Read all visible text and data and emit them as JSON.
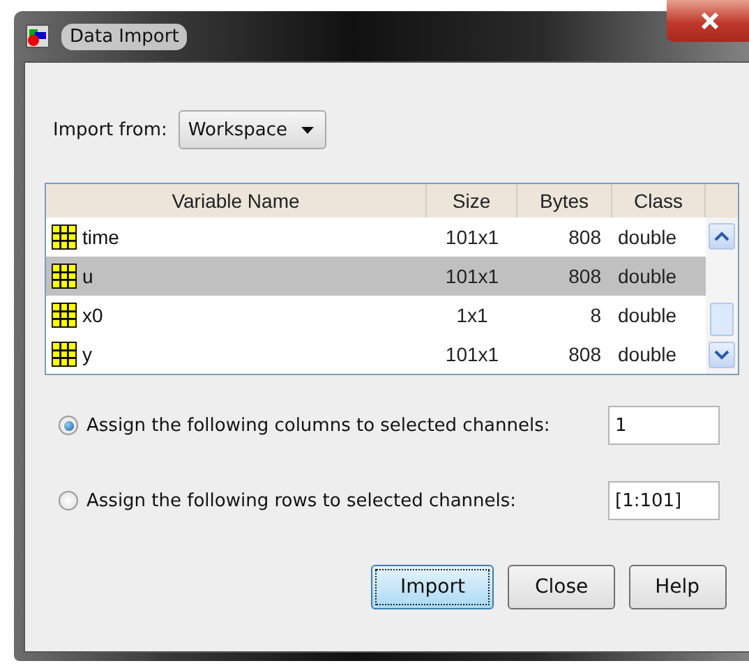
{
  "window": {
    "title": "Data Import"
  },
  "import_from": {
    "label": "Import from:",
    "value": "Workspace"
  },
  "table": {
    "columns": [
      "Variable Name",
      "Size",
      "Bytes",
      "Class"
    ],
    "rows": [
      {
        "name": "time",
        "size": "101x1",
        "bytes": "808",
        "class": "double",
        "selected": false
      },
      {
        "name": "u",
        "size": "101x1",
        "bytes": "808",
        "class": "double",
        "selected": true
      },
      {
        "name": "x0",
        "size": "1x1",
        "bytes": "8",
        "class": "double",
        "selected": false
      },
      {
        "name": "y",
        "size": "101x1",
        "bytes": "808",
        "class": "double",
        "selected": false
      }
    ]
  },
  "options": [
    {
      "label": "Assign the following columns to selected channels:",
      "value": "1",
      "selected": true
    },
    {
      "label": "Assign the following rows to selected channels:",
      "value": "[1:101]",
      "selected": false
    }
  ],
  "buttons": [
    {
      "label": "Import",
      "focused": true
    },
    {
      "label": "Close",
      "focused": false
    },
    {
      "label": "Help",
      "focused": false
    }
  ]
}
